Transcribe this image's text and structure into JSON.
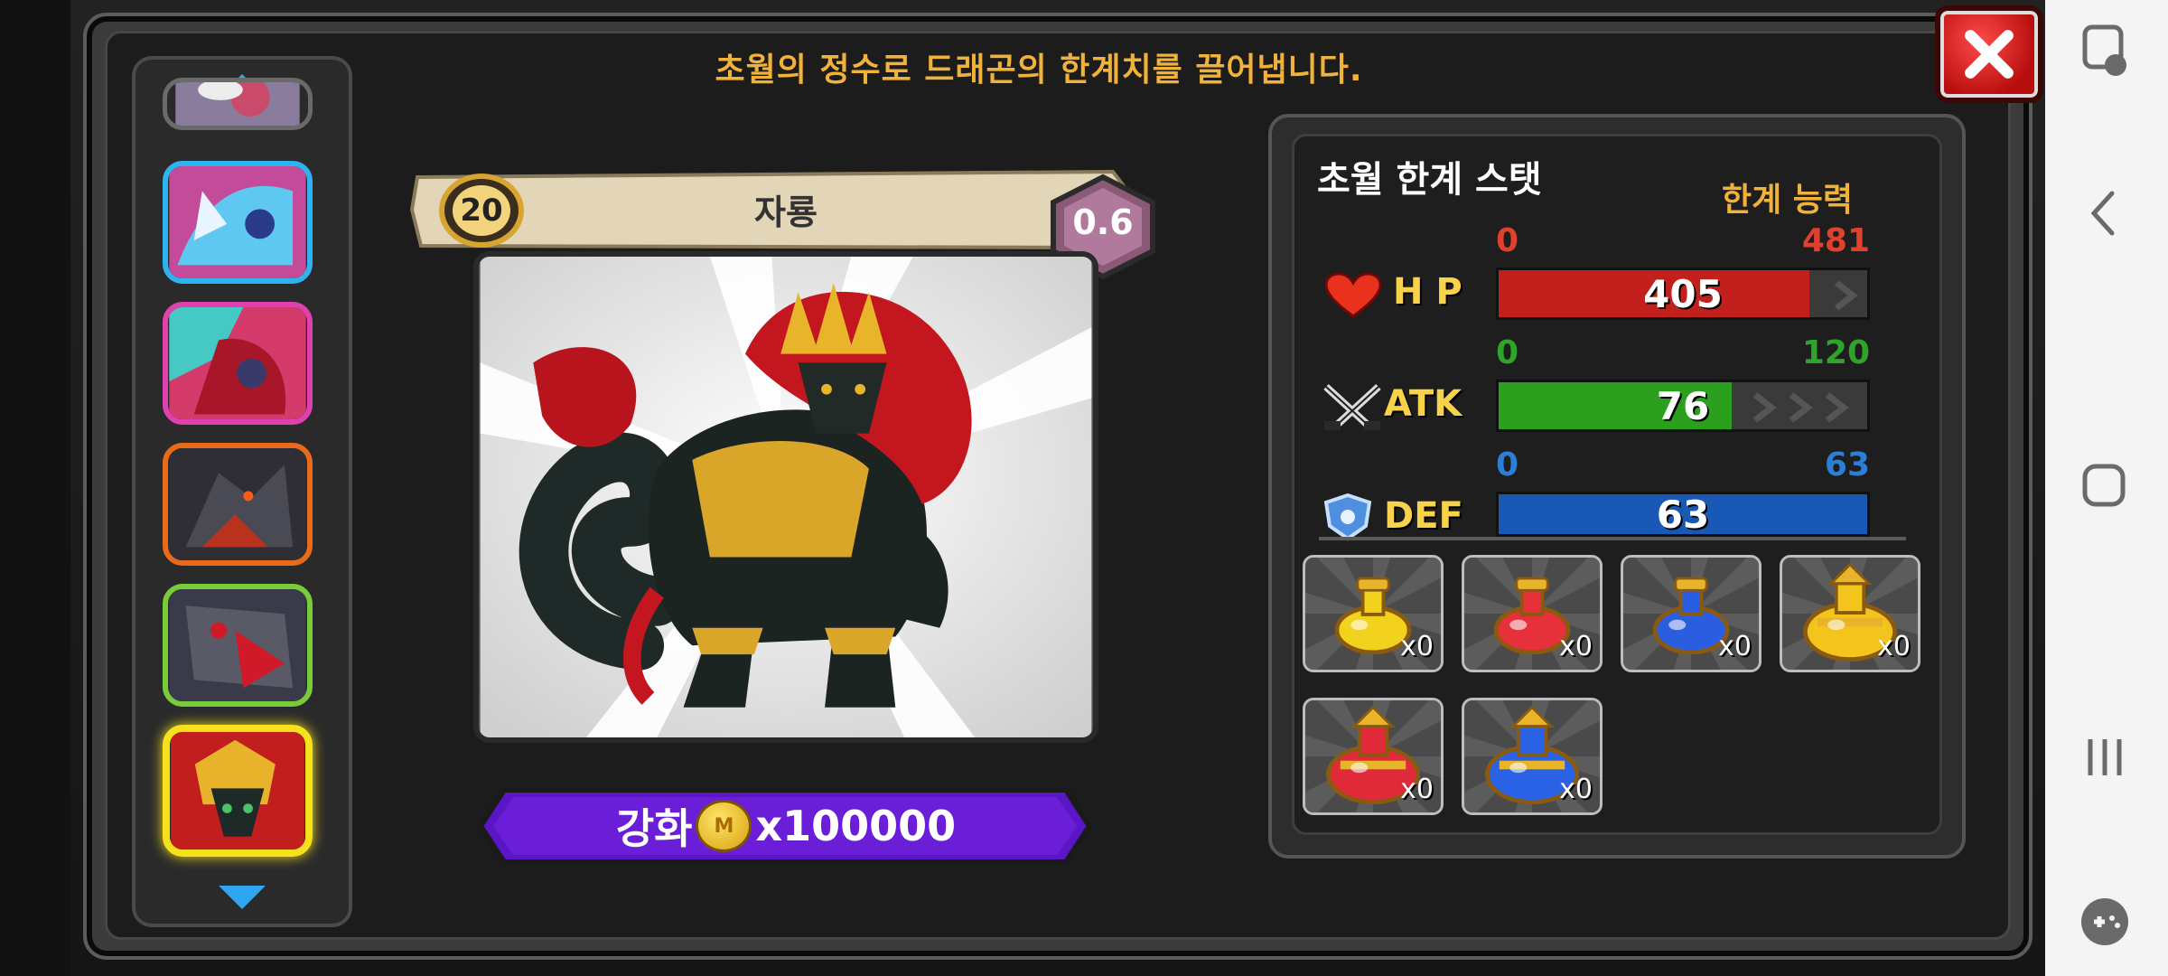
{
  "header": {
    "text": "초월의 정수로 드래곤의 한계치를 끌어냅니다."
  },
  "dragon": {
    "level": "20",
    "name": "자룡",
    "grade": "0.6"
  },
  "upgrade": {
    "label": "강화",
    "coin_symbol": "M",
    "cost": "x100000"
  },
  "stats_panel": {
    "title": "초월 한계 스탯",
    "subtitle": "한계 능력",
    "stats": [
      {
        "label": "H P",
        "min": "0",
        "max": "481",
        "value": "405",
        "fraction": 0.842,
        "color": "#c1201c",
        "range_color": "#e0402e"
      },
      {
        "label": "ATK",
        "min": "0",
        "max": "120",
        "value": "76",
        "fraction": 0.633,
        "color": "#2aa01e",
        "range_color": "#2fa32a"
      },
      {
        "label": "DEF",
        "min": "0",
        "max": "63",
        "value": "63",
        "fraction": 1.0,
        "color": "#1a58b6",
        "range_color": "#2b7fd6"
      }
    ]
  },
  "items": [
    {
      "name": "yellow-potion",
      "count": "x0",
      "color": "#f2d21c"
    },
    {
      "name": "red-potion",
      "count": "x0",
      "color": "#e6303a"
    },
    {
      "name": "blue-potion",
      "count": "x0",
      "color": "#2b5de0"
    },
    {
      "name": "large-yellow-potion",
      "count": "x0",
      "color": "#f2c41c"
    },
    {
      "name": "large-red-potion",
      "count": "x0",
      "color": "#e02a3a"
    },
    {
      "name": "large-blue-potion",
      "count": "x0",
      "color": "#2a62e6"
    }
  ],
  "roster": {
    "thumbs": [
      {
        "name": "dragon-thumb-partial",
        "border": "#6a6a6a"
      },
      {
        "name": "dragon-thumb-ice",
        "border": "#2fb3f0"
      },
      {
        "name": "dragon-thumb-pink",
        "border": "#e040b0"
      },
      {
        "name": "dragon-thumb-dark",
        "border": "#e86a1a"
      },
      {
        "name": "dragon-thumb-rainbow",
        "border": "#7acb3a"
      },
      {
        "name": "dragon-thumb-selected",
        "border": "#f5e21c"
      }
    ]
  }
}
